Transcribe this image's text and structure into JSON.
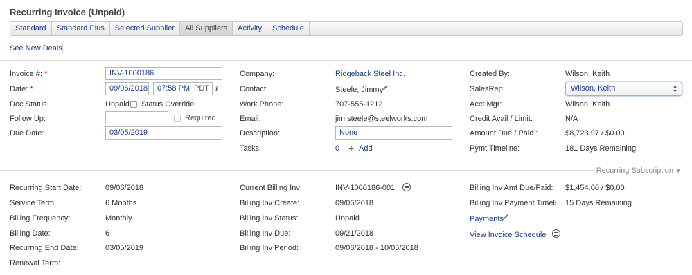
{
  "page": {
    "title": "Recurring Invoice (Unpaid)"
  },
  "tabs": [
    "Standard",
    "Standard Plus",
    "Selected Supplier",
    "All Suppliers",
    "Activity",
    "Schedule"
  ],
  "active_tab": "All Suppliers",
  "see_new_deals": "See New Deals",
  "left": {
    "invoice_label": "Invoice #:",
    "invoice_value": "INV-1000186",
    "date_label": "Date:",
    "date_value": "09/06/2018",
    "time_value": "07:58 PM",
    "tz": "PDT",
    "doc_status_label": "Doc Status:",
    "doc_status_value": "Unpaid",
    "status_override": "Status Override",
    "follow_up_label": "Follow Up:",
    "follow_up_value": "",
    "required_label": "Required",
    "due_date_label": "Due Date:",
    "due_date_value": "03/05/2019",
    "required_marker": "*"
  },
  "middle": {
    "company_label": "Company:",
    "company_value": "Ridgeback Steel Inc.",
    "contact_label": "Contact:",
    "contact_value": "Steele, Jimmy",
    "work_phone_label": "Work Phone:",
    "work_phone_value": "707-555-1212",
    "email_label": "Email:",
    "email_value": "jim.steele@steelworks.com",
    "description_label": "Description:",
    "description_value": "None",
    "tasks_label": "Tasks:",
    "tasks_count": "0",
    "add_label": "Add"
  },
  "right": {
    "created_by_label": "Created By:",
    "created_by_value": "Wilson, Keith",
    "salesrep_label": "SalesRep:",
    "salesrep_value": "Wilson, Keith",
    "acct_mgr_label": "Acct Mgr:",
    "acct_mgr_value": "Wilson, Keith",
    "credit_label": "Credit Avail / Limit:",
    "credit_value": "N/A",
    "amount_label": "Amount Due / Paid :",
    "amount_value": "$8,723.97 / $0.00",
    "pymt_label": "Pymt Timeline:",
    "pymt_value": "181 Days Remaining"
  },
  "section": {
    "title": "Recurring Subscription"
  },
  "recurring": {
    "start_label": "Recurring Start Date:",
    "start_value": "09/06/2018",
    "term_label": "Service Term:",
    "term_value": "6 Months",
    "freq_label": "Billing Frequency:",
    "freq_value": "Monthly",
    "billdate_label": "Billing Date:",
    "billdate_value": "6",
    "end_label": "Recurring End Date:",
    "end_value": "03/05/2019",
    "renewal_label": "Renewal Term:",
    "current_inv_label": "Current Billing Inv:",
    "current_inv_value": "INV-1000186-001",
    "create_label": "Billing Inv Create:",
    "create_value": "09/06/2018",
    "inv_status_label": "Billing Inv Status:",
    "inv_status_value": "Unpaid",
    "inv_due_label": "Billing Inv Due:",
    "inv_due_value": "09/21/2018",
    "inv_period_label": "Billing Inv Period:",
    "inv_period_value": "09/06/2018 - 10/05/2018",
    "amt_label": "Billing Inv Amt Due/Paid:",
    "amt_value": "$1,454.00 / $0.00",
    "timeline_label": "Billing Inv Payment Timeli...",
    "timeline_value": "15 Days Remaining",
    "payments_label": "Payments",
    "view_schedule_label": "View Invoice Schedule"
  }
}
